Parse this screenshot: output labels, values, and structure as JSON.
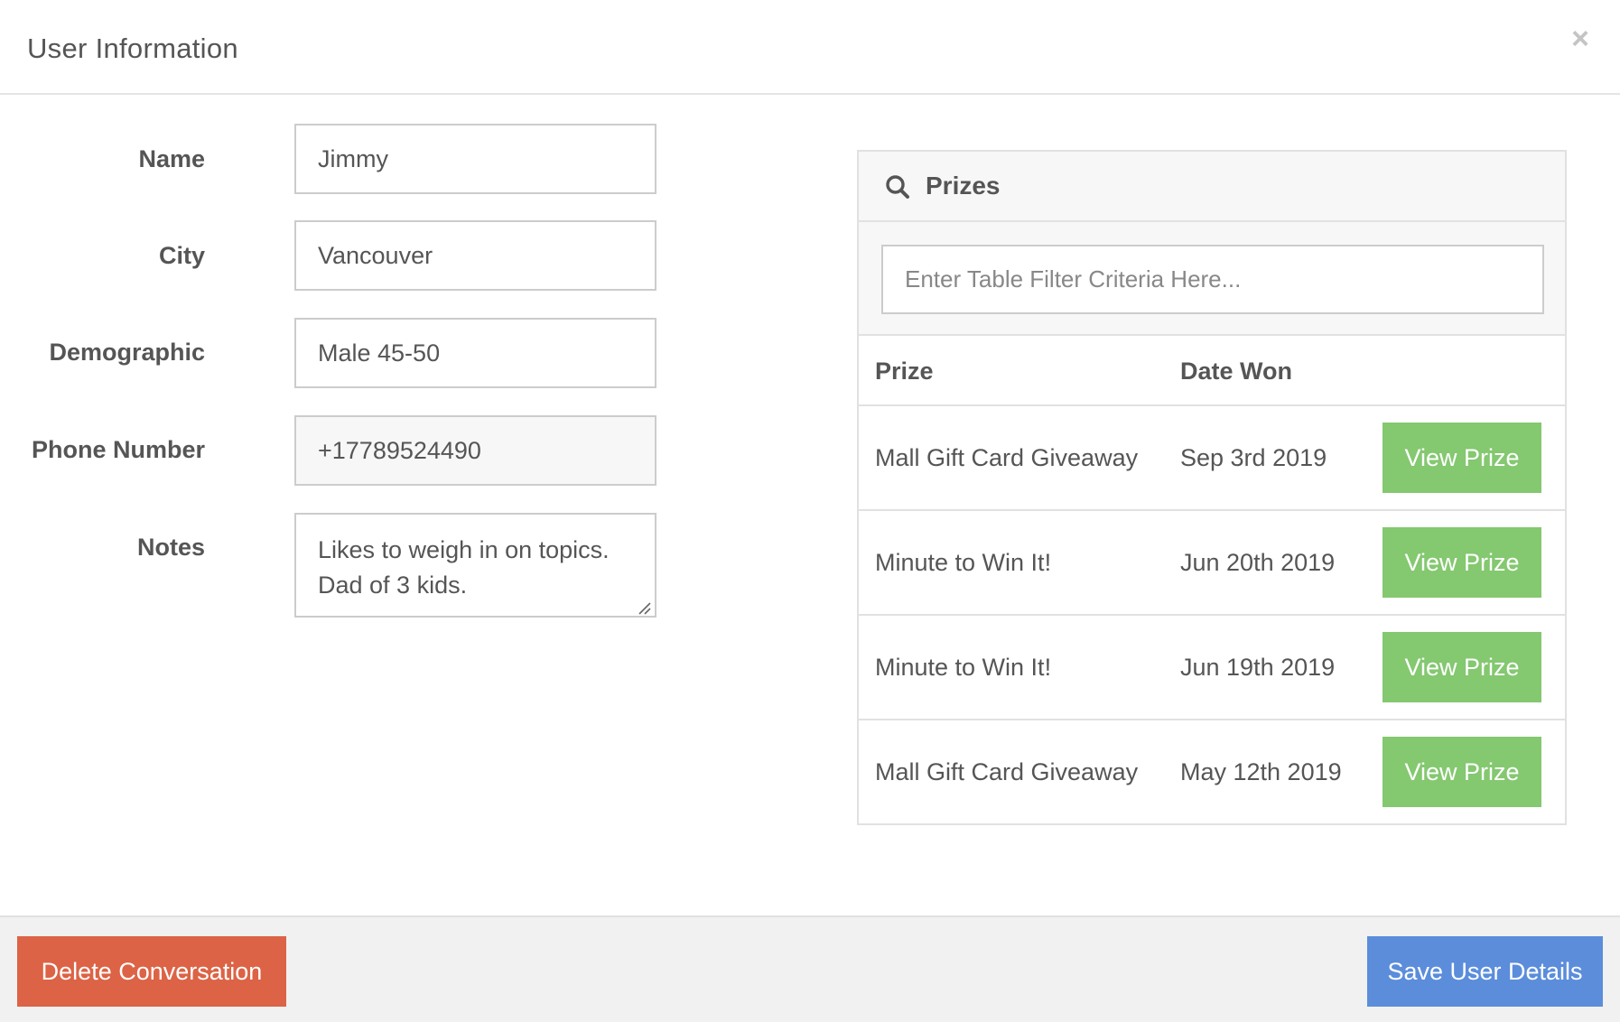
{
  "modal": {
    "title": "User Information",
    "close_symbol": "×"
  },
  "form": {
    "name": {
      "label": "Name",
      "value": "Jimmy"
    },
    "city": {
      "label": "City",
      "value": "Vancouver"
    },
    "demographic": {
      "label": "Demographic",
      "value": "Male 45-50"
    },
    "phone": {
      "label": "Phone Number",
      "value": "+17789524490"
    },
    "notes": {
      "label": "Notes",
      "value": "Likes to weigh in on topics. Dad of 3 kids."
    }
  },
  "prizes": {
    "title": "Prizes",
    "icon": "search-icon",
    "filter_placeholder": "Enter Table Filter Criteria Here...",
    "columns": [
      "Prize",
      "Date Won"
    ],
    "rows": [
      {
        "prize": "Mall Gift Card Giveaway",
        "date": "Sep 3rd 2019",
        "action": "View Prize"
      },
      {
        "prize": "Minute to Win It!",
        "date": "Jun 20th 2019",
        "action": "View Prize"
      },
      {
        "prize": "Minute to Win It!",
        "date": "Jun 19th 2019",
        "action": "View Prize"
      },
      {
        "prize": "Mall Gift Card Giveaway",
        "date": "May 12th 2019",
        "action": "View Prize"
      }
    ]
  },
  "footer": {
    "delete_label": "Delete Conversation",
    "save_label": "Save User Details"
  },
  "colors": {
    "view_button": "#84c870",
    "delete_button": "#dc6346",
    "save_button": "#5b8ddb"
  }
}
